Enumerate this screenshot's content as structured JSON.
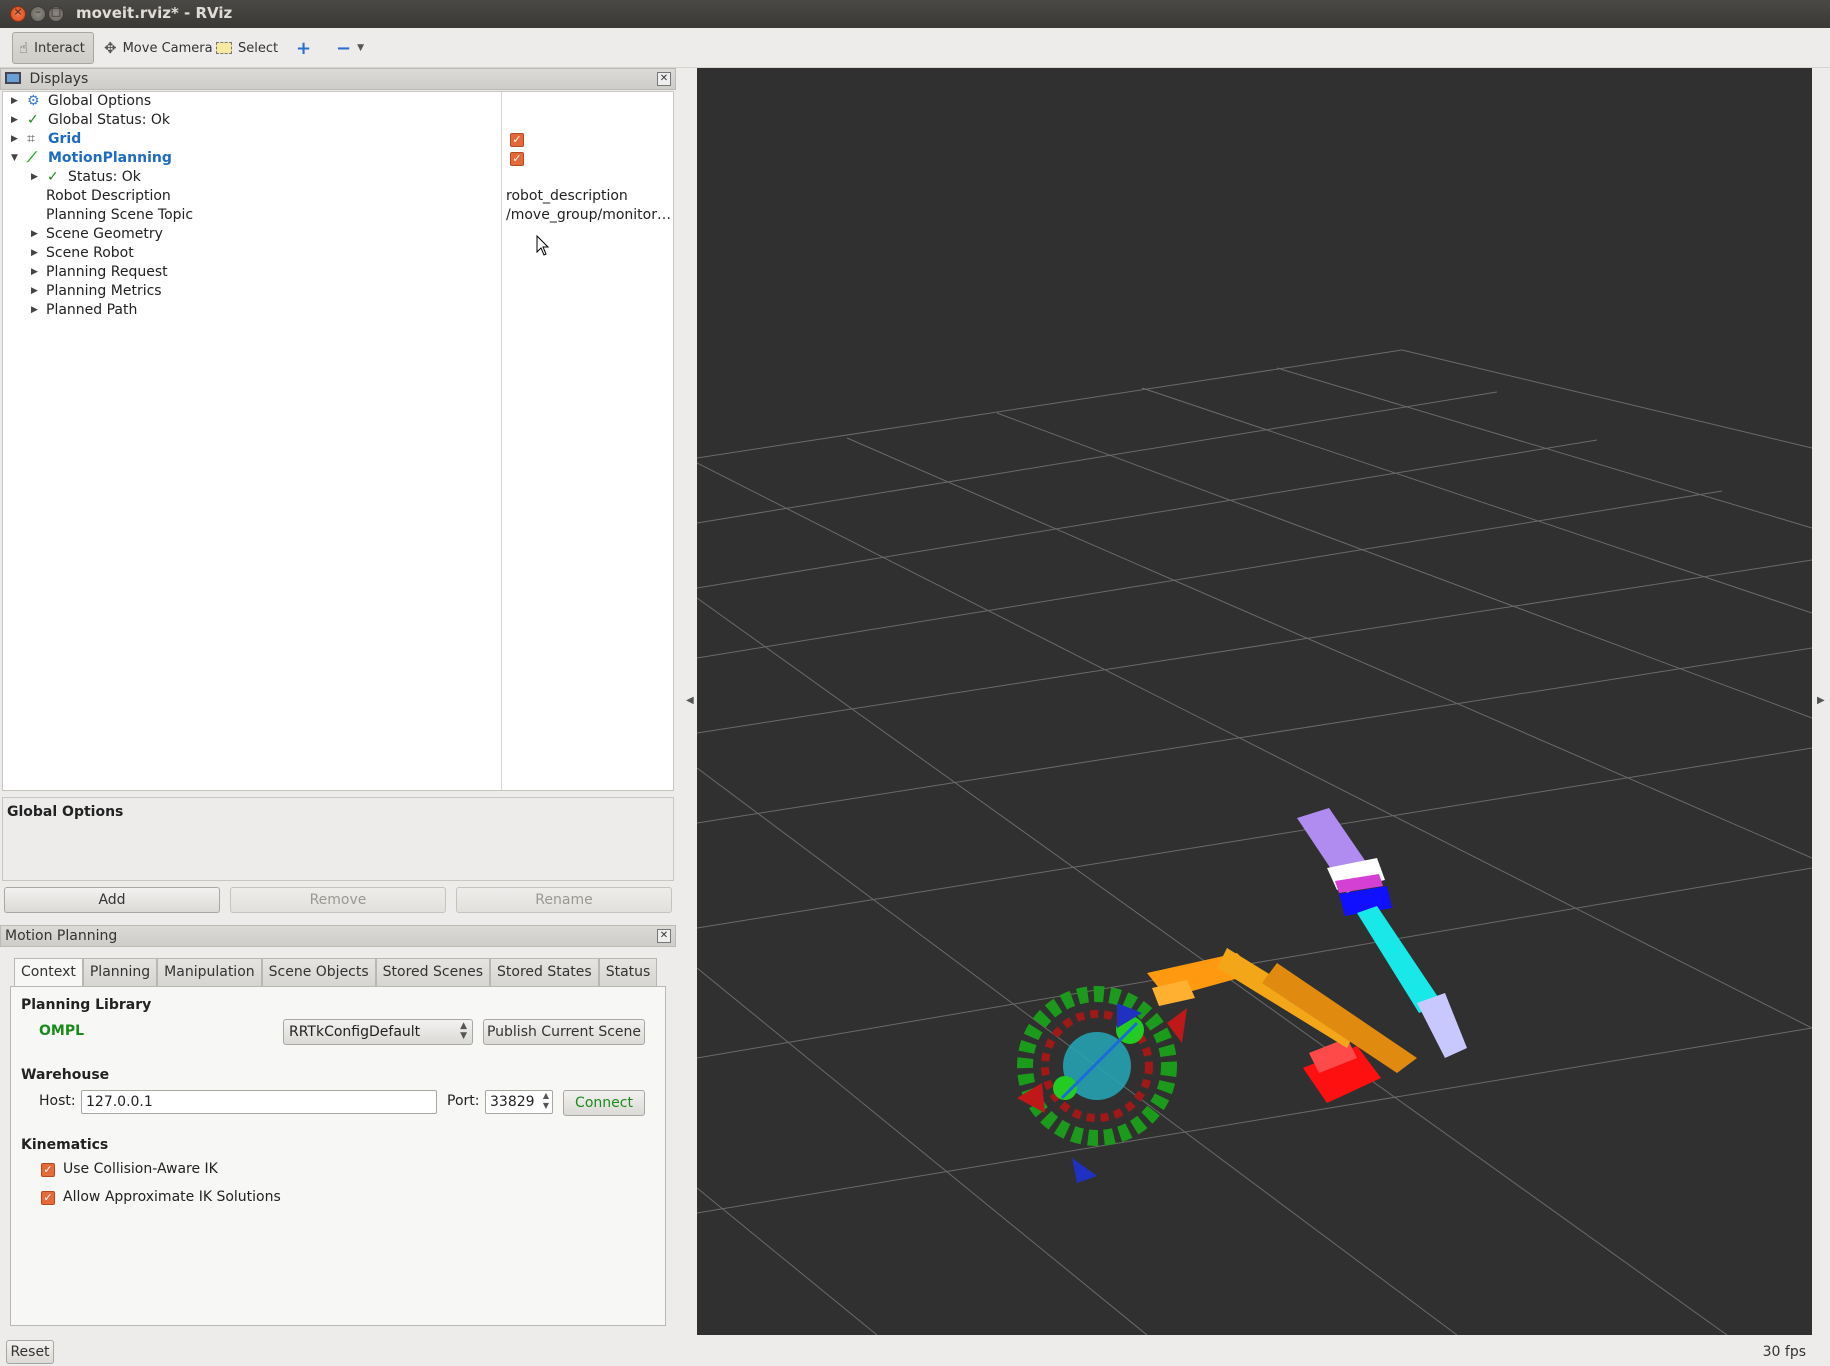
{
  "window": {
    "title": "moveit.rviz* - RViz"
  },
  "toolbar": {
    "interact": "Interact",
    "move_camera": "Move Camera",
    "select": "Select"
  },
  "displays": {
    "header": "Displays",
    "items": [
      {
        "label": "Global Options"
      },
      {
        "label": "Global Status: Ok"
      },
      {
        "label": "Grid",
        "enabled": true
      },
      {
        "label": "MotionPlanning",
        "enabled": true
      },
      {
        "label": "Status: Ok"
      },
      {
        "label": "Robot Description",
        "value": "robot_description"
      },
      {
        "label": "Planning Scene Topic",
        "value": "/move_group/monitor…"
      },
      {
        "label": "Scene Geometry"
      },
      {
        "label": "Scene Robot"
      },
      {
        "label": "Planning Request"
      },
      {
        "label": "Planning Metrics"
      },
      {
        "label": "Planned Path"
      }
    ]
  },
  "description": {
    "title": "Global Options"
  },
  "display_buttons": {
    "add": "Add",
    "remove": "Remove",
    "rename": "Rename"
  },
  "motion_planning": {
    "header": "Motion Planning",
    "tabs": [
      "Context",
      "Planning",
      "Manipulation",
      "Scene Objects",
      "Stored Scenes",
      "Stored States",
      "Status"
    ],
    "planning_library": {
      "title": "Planning Library",
      "name": "OMPL",
      "planner": "RRTkConfigDefault",
      "publish_label": "Publish Current Scene"
    },
    "warehouse": {
      "title": "Warehouse",
      "host_label": "Host:",
      "host": "127.0.0.1",
      "port_label": "Port:",
      "port": "33829",
      "connect_label": "Connect"
    },
    "kinematics": {
      "title": "Kinematics",
      "collision_aware_ik": "Use Collision-Aware IK",
      "approx_ik": "Allow Approximate IK Solutions"
    }
  },
  "statusbar": {
    "reset": "Reset",
    "fps": "30 fps"
  },
  "colors": {
    "viewport_bg": "#303030",
    "grid": "#6a6a6a",
    "check_orange": "#e56a3a",
    "link_blue": "#1e6bc4",
    "ok_green": "#1a8a1a"
  }
}
